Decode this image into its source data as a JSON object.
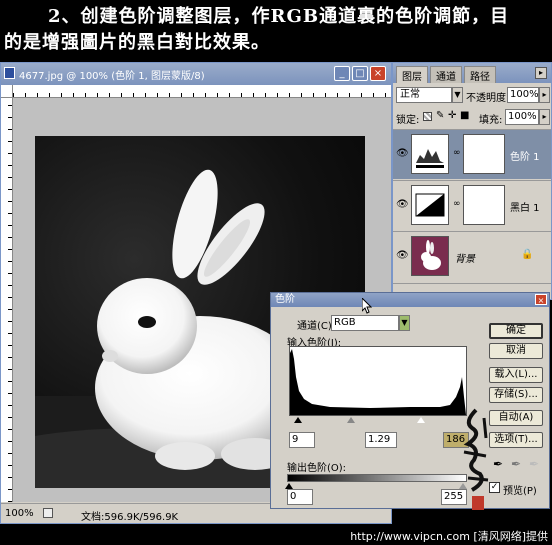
{
  "caption": {
    "line1": "2、创建色阶调整图层，作RGB通道裏的色阶调節，目",
    "line2": "的是增强圖片的黑白對比效果。"
  },
  "document": {
    "title": "4677.jpg @ 100% (色阶 1, 图层蒙版/8)",
    "zoom": "100%",
    "doc_size": "文档:596.9K/596.9K",
    "min_btn": "_",
    "max_btn": "□",
    "close_btn": "×"
  },
  "layers_panel": {
    "tabs": [
      "图层",
      "通道",
      "路径"
    ],
    "blend_mode": "正常",
    "opacity_label": "不透明度:",
    "opacity": "100%",
    "lock_label": "锁定:",
    "fill_label": "填充:",
    "fill": "100%",
    "layers": [
      {
        "name": "色阶 1",
        "active": true
      },
      {
        "name": "黑白 1",
        "active": false
      },
      {
        "name": "背景",
        "active": false
      }
    ]
  },
  "levels_dialog": {
    "title": "色阶",
    "channel_label": "通道(C):",
    "channel_value": "RGB",
    "input_label": "输入色阶(I):",
    "input_black": "9",
    "input_gamma": "1.29",
    "input_white": "186",
    "output_label": "输出色阶(O):",
    "output_black": "0",
    "output_white": "255",
    "buttons": {
      "ok": "确定",
      "cancel": "取消",
      "load": "载入(L)...",
      "save": "存储(S)...",
      "auto": "自动(A)",
      "options": "选项(T)..."
    },
    "preview_label": "预览(P)",
    "preview_checked": true
  },
  "watermark": "飘扬的海",
  "footer": "http://www.vipcn.com [清风网络]提供"
}
